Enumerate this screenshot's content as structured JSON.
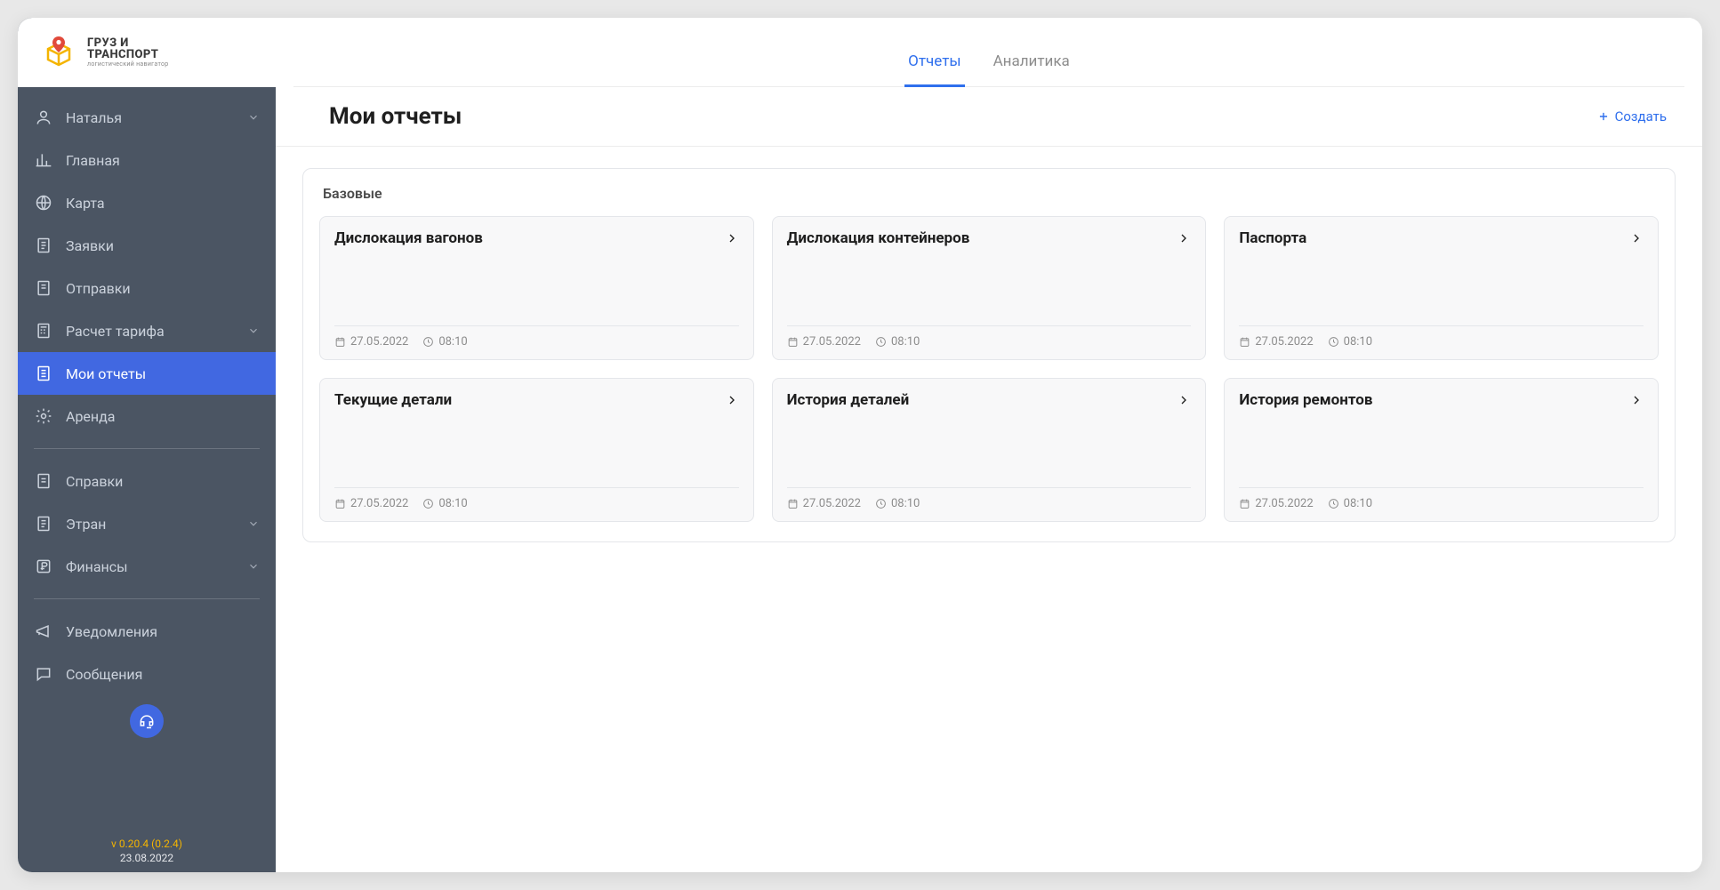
{
  "brand": {
    "line1": "ГРУЗ И",
    "line2": "ТРАНСПОРТ",
    "sub": "логистический навигатор"
  },
  "sidebar": {
    "user": {
      "label": "Наталья"
    },
    "home": {
      "label": "Главная"
    },
    "map": {
      "label": "Карта"
    },
    "requests": {
      "label": "Заявки"
    },
    "shipments": {
      "label": "Отправки"
    },
    "tariff": {
      "label": "Расчет тарифа"
    },
    "reports": {
      "label": "Мои отчеты"
    },
    "rent": {
      "label": "Аренда"
    },
    "refs": {
      "label": "Справки"
    },
    "etran": {
      "label": "Этран"
    },
    "finance": {
      "label": "Финансы"
    },
    "notify": {
      "label": "Уведомления"
    },
    "messages": {
      "label": "Сообщения"
    }
  },
  "footer": {
    "version": "v 0.20.4 (0.2.4)",
    "date": "23.08.2022"
  },
  "tabs": {
    "reports": "Отчеты",
    "analytics": "Аналитика"
  },
  "page": {
    "title": "Мои отчеты",
    "create": "Создать"
  },
  "section": {
    "basic": "Базовые"
  },
  "cards": {
    "0": {
      "title": "Дислокация вагонов",
      "date": "27.05.2022",
      "time": "08:10"
    },
    "1": {
      "title": "Дислокация контейнеров",
      "date": "27.05.2022",
      "time": "08:10"
    },
    "2": {
      "title": "Паспорта",
      "date": "27.05.2022",
      "time": "08:10"
    },
    "3": {
      "title": "Текущие детали",
      "date": "27.05.2022",
      "time": "08:10"
    },
    "4": {
      "title": "История деталей",
      "date": "27.05.2022",
      "time": "08:10"
    },
    "5": {
      "title": "История ремонтов",
      "date": "27.05.2022",
      "time": "08:10"
    }
  }
}
